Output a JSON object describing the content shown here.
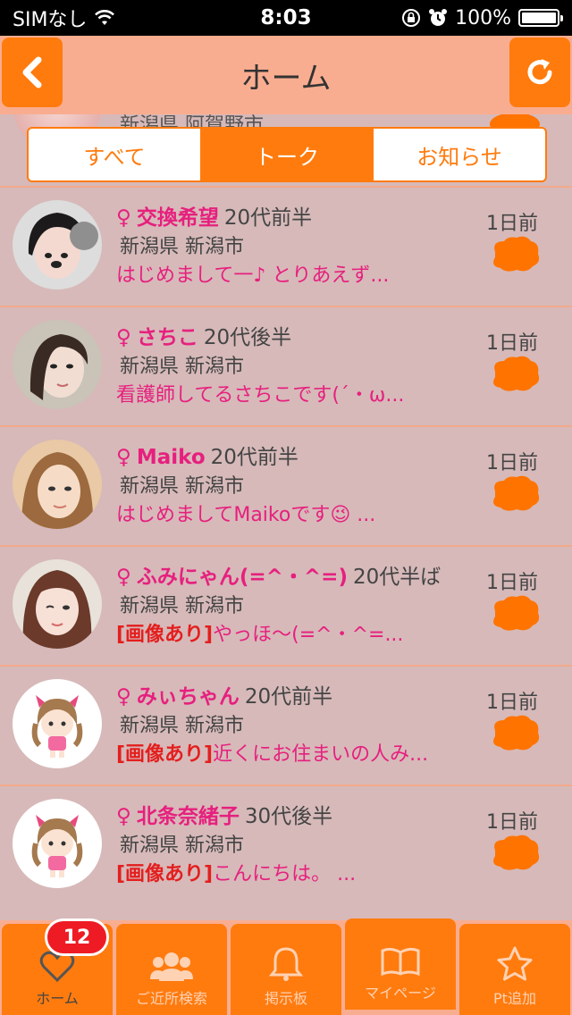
{
  "status_bar": {
    "carrier": "SIMなし",
    "time": "8:03",
    "battery": "100%"
  },
  "header": {
    "title": "ホーム"
  },
  "peek": {
    "location": "新潟県 阿賀野市"
  },
  "tabs": [
    {
      "label": "すべて",
      "active": false
    },
    {
      "label": "トーク",
      "active": true
    },
    {
      "label": "お知らせ",
      "active": false
    }
  ],
  "users": [
    {
      "gender": "♀",
      "name": "交換希望",
      "age": "20代前半",
      "location": "新潟県 新潟市",
      "tag": "",
      "message": "はじめまして一♪ とりあえず...",
      "time": "1日前"
    },
    {
      "gender": "♀",
      "name": "さちこ",
      "age": "20代後半",
      "location": "新潟県 新潟市",
      "tag": "",
      "message": "看護師してるさちこです(´・ω...",
      "time": "1日前"
    },
    {
      "gender": "♀",
      "name": "Maiko",
      "age": "20代前半",
      "location": "新潟県 新潟市",
      "tag": "",
      "message": "はじめましてMaikoです😉 ...",
      "time": "1日前"
    },
    {
      "gender": "♀",
      "name": "ふみにゃん(=^・^=)",
      "age": "20代半ば",
      "location": "新潟県 新潟市",
      "tag": "[画像あり]",
      "message": "やっほ〜(=^・^=...",
      "time": "1日前"
    },
    {
      "gender": "♀",
      "name": "みぃちゃん",
      "age": "20代前半",
      "location": "新潟県 新潟市",
      "tag": "[画像あり]",
      "message": "近くにお住まいの人み...",
      "time": "1日前"
    },
    {
      "gender": "♀",
      "name": "北条奈緒子",
      "age": "30代後半",
      "location": "新潟県 新潟市",
      "tag": "[画像あり]",
      "message": "こんにちは。 ...",
      "time": "1日前"
    }
  ],
  "bottom_nav": [
    {
      "label": "ホーム",
      "icon": "heart-icon",
      "badge": "12",
      "active": true
    },
    {
      "label": "ご近所検索",
      "icon": "people-icon"
    },
    {
      "label": "掲示板",
      "icon": "bell-icon"
    },
    {
      "label": "マイページ",
      "icon": "book-icon"
    },
    {
      "label": "Pt追加",
      "icon": "star-icon"
    }
  ],
  "colors": {
    "accent": "#ff7b0e",
    "header_bg": "#f9ad90",
    "list_bg": "#d7b9b9",
    "name_pink": "#e6207e",
    "tag_red": "#e41e1e",
    "badge_red": "#ee1b24"
  }
}
